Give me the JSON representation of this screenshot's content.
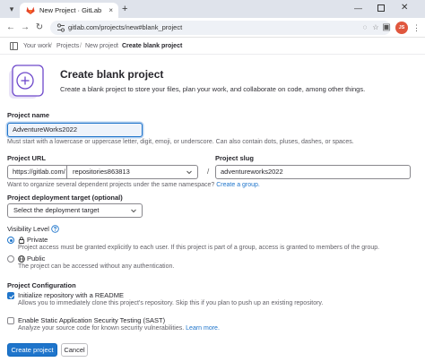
{
  "browser": {
    "tab_title": "New Project · GitLab",
    "tab_close": "×",
    "new_tab": "+",
    "url": "gitlab.com/projects/new#blank_project",
    "profile_initials": "JS",
    "accent": "#1f75cb"
  },
  "breadcrumb": {
    "items": [
      "Your work",
      "Projects",
      "New project",
      "Create blank project"
    ],
    "separator": "/"
  },
  "header": {
    "title": "Create blank project",
    "description": "Create a blank project to store your files, plan your work, and collaborate on code, among other things."
  },
  "form": {
    "project_name": {
      "label": "Project name",
      "value": "AdventureWorks2022",
      "help": "Must start with a lowercase or uppercase letter, digit, emoji, or underscore. Can also contain dots, pluses, dashes, or spaces."
    },
    "project_url": {
      "label": "Project URL",
      "prefix": "https://gitlab.com/",
      "namespace": "repositories863813",
      "separator": "/",
      "help_text": "Want to organize several dependent projects under the same namespace?",
      "help_link": "Create a group."
    },
    "project_slug": {
      "label": "Project slug",
      "value": "adventureworks2022"
    },
    "deployment_target": {
      "label": "Project deployment target (optional)",
      "placeholder": "Select the deployment target"
    },
    "visibility": {
      "label": "Visibility Level",
      "options": [
        {
          "label": "Private",
          "help": "Project access must be granted explicitly to each user. If this project is part of a group, access is granted to members of the group.",
          "selected": true
        },
        {
          "label": "Public",
          "help": "The project can be accessed without any authentication.",
          "selected": false
        }
      ]
    },
    "configuration": {
      "label": "Project Configuration",
      "options": [
        {
          "label": "Initialize repository with a README",
          "help": "Allows you to immediately clone this project's repository. Skip this if you plan to push up an existing repository.",
          "checked": true,
          "link": ""
        },
        {
          "label": "Enable Static Application Security Testing (SAST)",
          "help": "Analyze your source code for known security vulnerabilities.",
          "checked": false,
          "link": "Learn more."
        }
      ]
    },
    "submit_label": "Create project",
    "cancel_label": "Cancel"
  }
}
